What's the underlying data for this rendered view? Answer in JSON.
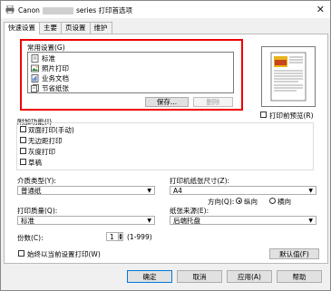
{
  "window": {
    "title_prefix": "Canon",
    "title_suffix": "series 打印首选项",
    "close_symbol": "✕"
  },
  "tabs": [
    "快速设置",
    "主要",
    "页设置",
    "维护"
  ],
  "common_settings": {
    "label": "常用设置(G)",
    "items": [
      "标准",
      "照片打印",
      "业务文档",
      "节省纸张"
    ],
    "save_label": "保存...",
    "delete_label": "删除"
  },
  "preview": {
    "always_preview_label": "打印前预览(R)"
  },
  "additional": {
    "label": "附加功能(I)",
    "options": [
      "双面打印(手动)",
      "无边距打印",
      "灰度打印",
      "草稿"
    ]
  },
  "media": {
    "label": "介质类型(Y):",
    "value": "普通纸"
  },
  "paper_size": {
    "label": "打印机纸张尺寸(Z):",
    "value": "A4"
  },
  "orientation": {
    "label": "方向(Q):",
    "portrait": "纵向",
    "landscape": "横向"
  },
  "quality": {
    "label": "打印质量(Q):",
    "value": "标准"
  },
  "paper_source": {
    "label": "纸张来源(E):",
    "value": "后端托盘"
  },
  "copies": {
    "label": "份数(C):",
    "value": "1",
    "range": "(1-999)"
  },
  "always_print": {
    "label": "始终以当前设置打印(W)"
  },
  "defaults_label": "默认值(F)",
  "footer": {
    "ok": "确定",
    "cancel": "取消",
    "apply": "应用(A)",
    "help": "帮助"
  }
}
